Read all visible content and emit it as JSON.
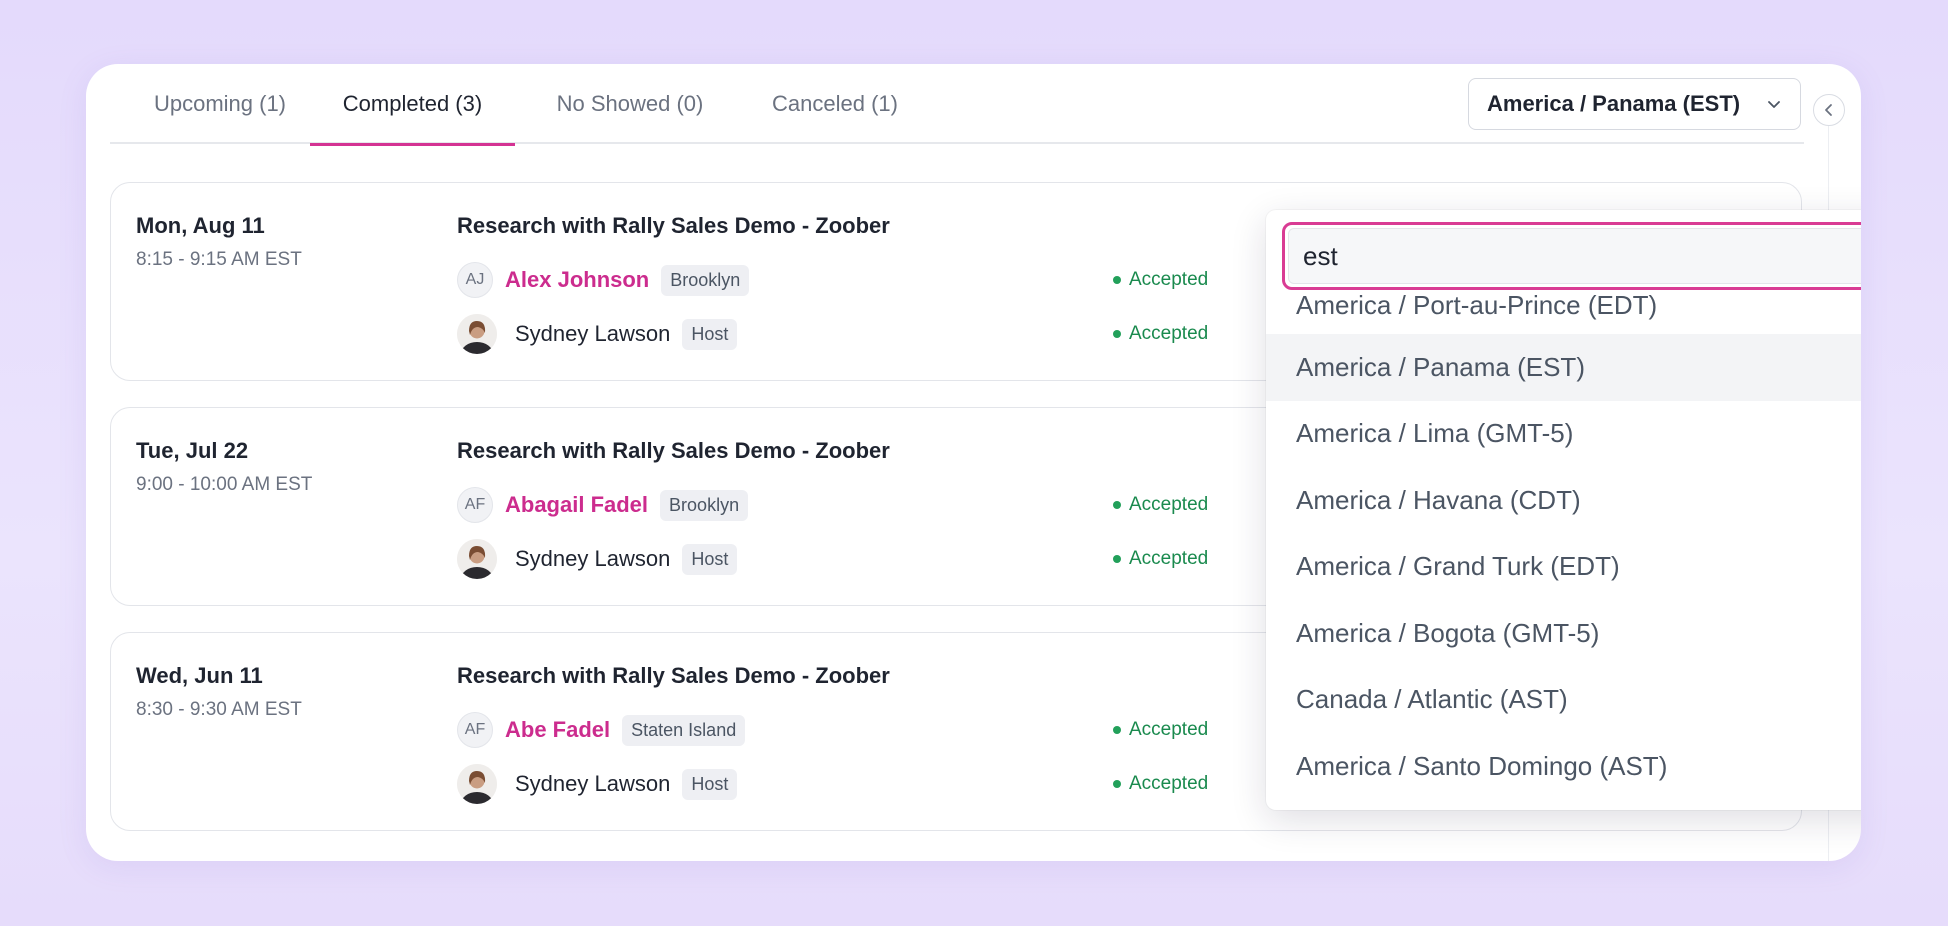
{
  "tabs": [
    {
      "label": "Upcoming (1)"
    },
    {
      "label": "Completed (3)"
    },
    {
      "label": "No Showed (0)"
    },
    {
      "label": "Canceled (1)"
    }
  ],
  "active_tab": "Completed (3)",
  "timezone_select": {
    "value": "America / Panama (EST)"
  },
  "sessions": [
    {
      "date": "Mon, Aug 11",
      "time": "8:15 - 9:15 AM EST",
      "title": "Research with Rally Sales Demo - Zoober",
      "participant": {
        "initials": "AJ",
        "name": "Alex Johnson",
        "tag": "Brooklyn",
        "status": "Accepted"
      },
      "host": {
        "name": "Sydney Lawson",
        "tag": "Host",
        "status": "Accepted"
      }
    },
    {
      "date": "Tue, Jul 22",
      "time": "9:00 - 10:00 AM EST",
      "title": "Research with Rally Sales Demo - Zoober",
      "participant": {
        "initials": "AF",
        "name": "Abagail Fadel",
        "tag": "Brooklyn",
        "status": "Accepted"
      },
      "host": {
        "name": "Sydney Lawson",
        "tag": "Host",
        "status": "Accepted"
      }
    },
    {
      "date": "Wed, Jun 11",
      "time": "8:30 - 9:30 AM EST",
      "title": "Research with Rally Sales Demo - Zoober",
      "participant": {
        "initials": "AF",
        "name": "Abe Fadel",
        "tag": "Staten Island",
        "status": "Accepted"
      },
      "host": {
        "name": "Sydney Lawson",
        "tag": "Host",
        "status": "Accepted"
      }
    }
  ],
  "dropdown": {
    "search_value": "est",
    "options": [
      "America / Port-au-Prince (EDT)",
      "America / Panama (EST)",
      "America / Lima (GMT-5)",
      "America / Havana (CDT)",
      "America / Grand Turk (EDT)",
      "America / Bogota (GMT-5)",
      "Canada / Atlantic (AST)",
      "America / Santo Domingo (AST)"
    ],
    "highlighted": "America / Panama (EST)"
  },
  "colors": {
    "accent": "#d43393",
    "link": "#cc2c8e",
    "status_green": "#1a8a4e"
  },
  "icons": {
    "select_chevron": "chevron-down-icon",
    "collapse": "chevron-left-icon",
    "status": "status-dot-icon"
  }
}
